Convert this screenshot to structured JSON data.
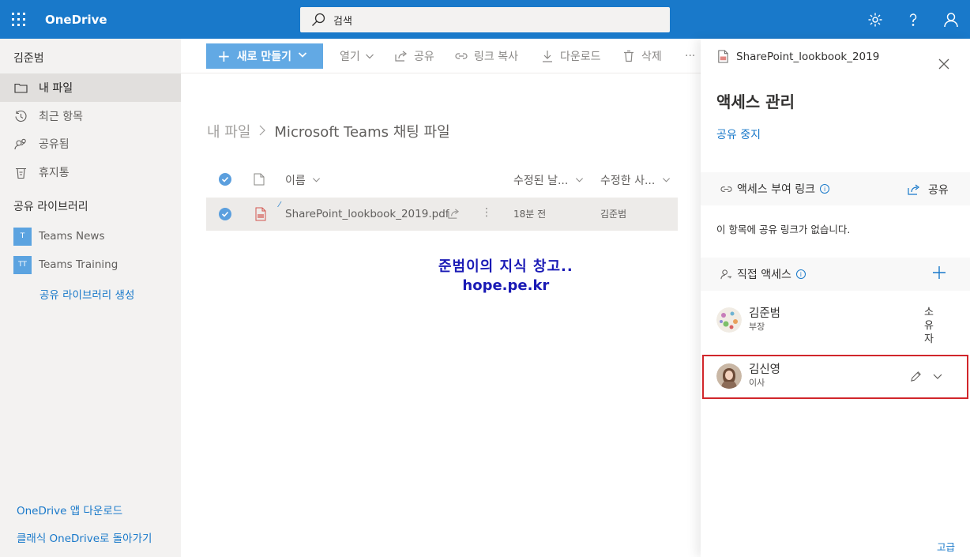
{
  "app": {
    "name": "OneDrive"
  },
  "search": {
    "placeholder": "검색"
  },
  "nav": {
    "user": "김준범",
    "items": [
      {
        "label": "내 파일",
        "icon": "folder-icon"
      },
      {
        "label": "최근 항목",
        "icon": "history-icon"
      },
      {
        "label": "공유됨",
        "icon": "people-icon"
      },
      {
        "label": "휴지통",
        "icon": "recycle-bin-icon"
      }
    ],
    "shared_libraries_title": "공유 라이브러리",
    "libraries": [
      {
        "badge": "T",
        "label": "Teams News"
      },
      {
        "badge": "TT",
        "label": "Teams Training"
      }
    ],
    "create_library": "공유 라이브러리 생성",
    "download_app": "OneDrive 앱 다운로드",
    "classic": "클래식 OneDrive로 돌아가기"
  },
  "commands": {
    "new": "새로 만들기",
    "open": "열기",
    "share": "공유",
    "copy_link": "링크 복사",
    "download": "다운로드",
    "delete": "삭제",
    "more": "···"
  },
  "breadcrumb": {
    "root": "내 파일",
    "current": "Microsoft Teams 채팅 파일"
  },
  "columns": {
    "name": "이름",
    "modified": "수정된 날...",
    "modified_by": "수정한 사..."
  },
  "file": {
    "name": "SharePoint_lookbook_2019.pdf",
    "modified": "18분 전",
    "modified_by": "김준범"
  },
  "watermark": {
    "line1": "준범이의 지식 창고..",
    "line2": "hope.pe.kr"
  },
  "panel": {
    "file_name": "SharePoint_lookbook_2019",
    "title": "액세스 관리",
    "stop_sharing": "공유 중지",
    "links_heading": "액세스 부여 링크",
    "share_label": "공유",
    "no_links": "이 항목에 공유 링크가 없습니다.",
    "direct_heading": "직접 액세스",
    "people": [
      {
        "name": "김준범",
        "role": "부장",
        "permission": "소유자"
      },
      {
        "name": "김신영",
        "role": "이사"
      }
    ],
    "advanced": "고급"
  },
  "colors": {
    "brand": "#1979ca",
    "highlight": "#d1262b"
  }
}
